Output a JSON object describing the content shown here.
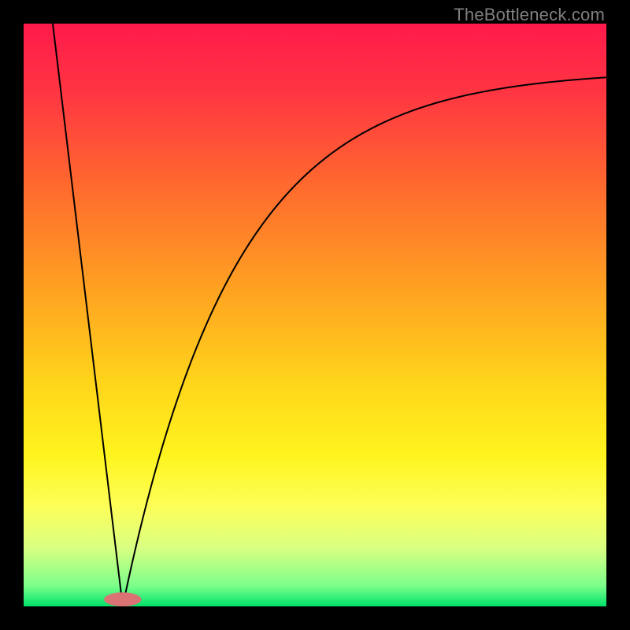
{
  "watermark": "TheBottleneck.com",
  "colors": {
    "frame": "#000000",
    "line": "#000000",
    "marker_fill": "#db7374",
    "gradient_stops": [
      {
        "offset": 0.0,
        "color": "#ff1a4b"
      },
      {
        "offset": 0.12,
        "color": "#ff3642"
      },
      {
        "offset": 0.28,
        "color": "#ff6a2e"
      },
      {
        "offset": 0.46,
        "color": "#ffa321"
      },
      {
        "offset": 0.62,
        "color": "#ffd61a"
      },
      {
        "offset": 0.74,
        "color": "#fff41e"
      },
      {
        "offset": 0.83,
        "color": "#fcff5a"
      },
      {
        "offset": 0.9,
        "color": "#d9ff82"
      },
      {
        "offset": 0.965,
        "color": "#7bff8a"
      },
      {
        "offset": 1.0,
        "color": "#00e26a"
      }
    ]
  },
  "chart_data": {
    "type": "line",
    "title": "",
    "xlabel": "",
    "ylabel": "",
    "xlim": [
      0,
      100
    ],
    "ylim": [
      0,
      100
    ],
    "note": "Visual bottleneck chart. Left branch is a line from (x≈5, y=100) down to the optimum at (x≈17, y=0). Right branch rises from the optimum along a saturating curve toward ~y=90 at x=100. The optimum location is highlighted with a pill marker sitting on the baseline.",
    "left_line": {
      "x": [
        5,
        17
      ],
      "y": [
        100,
        0
      ]
    },
    "right_curve": {
      "x0": 17,
      "asymptote": 92,
      "rate": 0.052,
      "comment": "y = asymptote * (1 - exp(-rate * (x - x0))) for x >= x0; values estimated from pixels"
    },
    "optimum_marker": {
      "x": 17,
      "y": 0,
      "rx_pct": 3.2,
      "ry_pct": 1.2
    }
  }
}
